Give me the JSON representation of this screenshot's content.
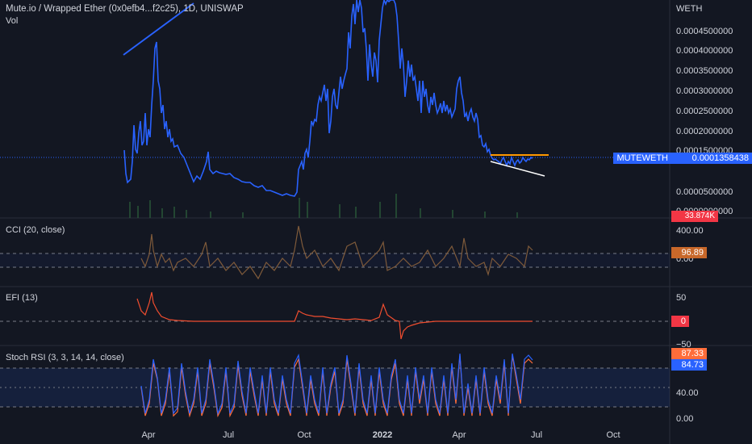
{
  "header": {
    "symbol_title": "Mute.io / Wrapped Ether (0x0efb4...f2c25), 1D, UNISWAP",
    "volume_label": "Vol",
    "currency": "WETH"
  },
  "price_axis": [
    "0.0004500000",
    "0.0004000000",
    "0.0003500000",
    "0.0003000000",
    "0.0002500000",
    "0.0002000000",
    "0.0001500000",
    "0.0000500000",
    "0.0000000000"
  ],
  "badges": {
    "symbol_name": "MUTEWETH",
    "last_price": "0.0001358438",
    "volume": "33.874K",
    "cci_value": "96.89",
    "efi_value": "0",
    "stoch_k": "87.33",
    "stoch_d": "84.73"
  },
  "indicators": {
    "cci": {
      "label": "CCI (20, close)",
      "axis": [
        "400.00",
        "0.00"
      ]
    },
    "efi": {
      "label": "EFI (13)",
      "axis": [
        "50",
        "−50"
      ]
    },
    "stoch": {
      "label": "Stoch RSI (3, 3, 14, 14, close)",
      "axis": [
        "40.00",
        "0.00"
      ]
    }
  },
  "time_axis": [
    "Apr",
    "Jul",
    "Oct",
    "2022",
    "Apr",
    "Jul",
    "Oct"
  ],
  "colors": {
    "background": "#131722",
    "price_line": "#2962ff",
    "cci_line": "#7e5a3a",
    "efi_line": "#f04d2f",
    "stoch_k": "#2962ff",
    "stoch_d": "#ff6d3a",
    "trend_orange": "#ff9800",
    "trend_white": "#ffffff",
    "badge_blue": "#2962ff",
    "badge_orange": "#c8682a",
    "badge_red": "#f23645"
  }
}
